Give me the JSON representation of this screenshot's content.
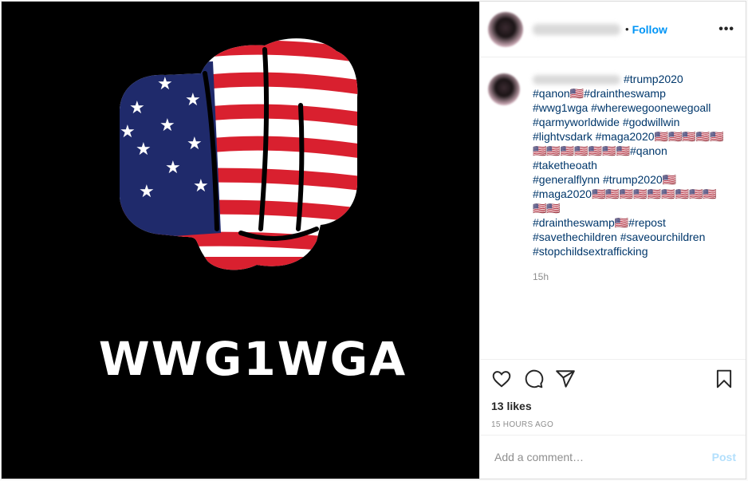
{
  "media": {
    "overlay_text": "WWG1WGA"
  },
  "header": {
    "dot": "•",
    "follow_label": "Follow",
    "more_label": "•••"
  },
  "caption": {
    "lines": [
      "#trump2020",
      "#qanon🇺🇸#draintheswamp",
      "#wwg1wga #wherewegoonewegoall",
      "#qarmyworldwide #godwillwin",
      "#lightvsdark #maga2020🇺🇸🇺🇸🇺🇸🇺🇸🇺🇸",
      "🇺🇸🇺🇸🇺🇸🇺🇸🇺🇸🇺🇸🇺🇸#qanon #taketheoath",
      "#generalflynn #trump2020🇺🇸",
      "#maga2020🇺🇸🇺🇸🇺🇸🇺🇸🇺🇸🇺🇸🇺🇸🇺🇸🇺🇸🇺🇸🇺🇸",
      "#draintheswamp🇺🇸#repost",
      "#savethechildren #saveourchildren",
      "#stopchildsextrafficking"
    ],
    "time": "15h"
  },
  "actions": {
    "icons": [
      "heart-icon",
      "comment-icon",
      "share-icon",
      "bookmark-icon"
    ],
    "likes": "13 likes",
    "ago": "15 HOURS AGO"
  },
  "comment": {
    "placeholder": "Add a comment…",
    "post_label": "Post"
  },
  "colors": {
    "link": "#00376b",
    "follow": "#0095f6",
    "post_disabled": "#b2dffc"
  }
}
